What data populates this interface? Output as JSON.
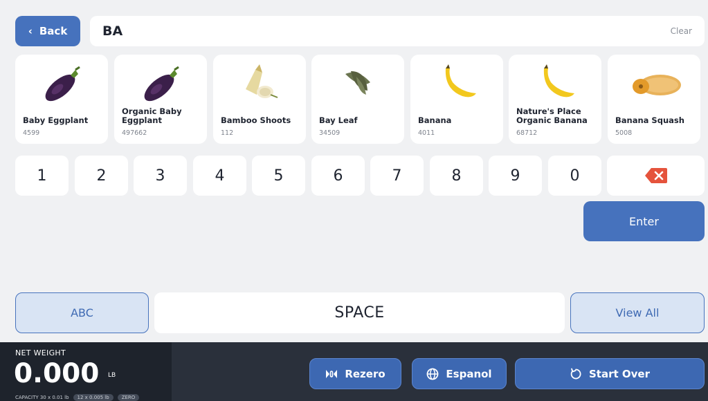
{
  "header": {
    "back_label": "Back",
    "search_value": "BA",
    "clear_label": "Clear"
  },
  "products": [
    {
      "name": "Baby Eggplant",
      "code": "4599",
      "icon": "eggplant-icon"
    },
    {
      "name": "Organic Baby Eggplant",
      "code": "497662",
      "icon": "eggplant-icon"
    },
    {
      "name": "Bamboo Shoots",
      "code": "112",
      "icon": "bamboo-shoots-icon"
    },
    {
      "name": "Bay Leaf",
      "code": "34509",
      "icon": "bay-leaf-icon"
    },
    {
      "name": "Banana",
      "code": "4011",
      "icon": "banana-icon"
    },
    {
      "name": "Nature's Place Organic Banana",
      "code": "68712",
      "icon": "banana-icon"
    },
    {
      "name": "Banana Squash",
      "code": "5008",
      "icon": "squash-icon"
    }
  ],
  "keypad": {
    "digits": [
      "1",
      "2",
      "3",
      "4",
      "5",
      "6",
      "7",
      "8",
      "9",
      "0"
    ],
    "backspace_icon": "backspace-icon",
    "enter_label": "Enter"
  },
  "bottom_keys": {
    "abc_label": "ABC",
    "space_label": "SPACE",
    "view_all_label": "View All"
  },
  "footer": {
    "net_weight_label": "NET WEIGHT",
    "weight_value": "0.000",
    "weight_unit": "LB",
    "capacity_text": "CAPACITY 30 x 0.01 lb",
    "capacity_pill": "12 x 0.005 lb",
    "zero_pill": "ZERO",
    "rezero_label": "Rezero",
    "espanol_label": "Espanol",
    "start_over_label": "Start Over"
  },
  "colors": {
    "accent": "#4672bd",
    "background": "#f0f1f3",
    "footer": "#2a303b",
    "delete": "#e5533c"
  }
}
